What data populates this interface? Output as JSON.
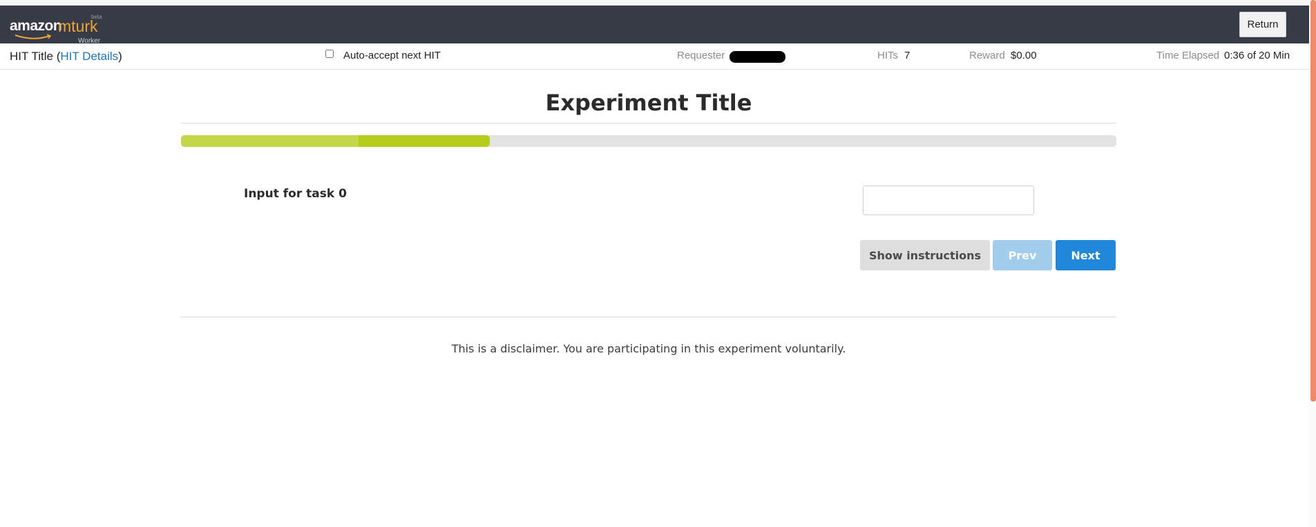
{
  "navbar": {
    "logo": {
      "amazon": "amazon",
      "mturk": "mturk",
      "beta": "beta",
      "worker": "Worker"
    },
    "return_label": "Return"
  },
  "infobar": {
    "hit_title": "HIT Title",
    "hit_details_link": "HIT Details",
    "auto_accept_label": "Auto-accept next HIT",
    "auto_accept_checked": false,
    "requester_label": "Requester",
    "hits_label": "HITs",
    "hits_value": "7",
    "reward_label": "Reward",
    "reward_value": "$0.00",
    "time_label": "Time Elapsed",
    "time_value": "0:36 of 20 Min"
  },
  "experiment": {
    "title": "Experiment Title",
    "progress": {
      "completed_fraction": 0.33,
      "segment_boundary_fraction": 0.19
    },
    "task_label": "Input for task 0",
    "input_value": "",
    "buttons": {
      "show_instructions": "Show instructions",
      "prev": "Prev",
      "next": "Next"
    },
    "disclaimer": "This is a disclaimer. You are participating in this experiment voluntarily."
  },
  "colors": {
    "navbar_bg": "#363b46",
    "mturk_orange": "#f0a33b",
    "link_blue": "#1f73b7",
    "progress_light": "#c2d84a",
    "progress_dark": "#b5cc1a",
    "next_blue": "#2187d9",
    "prev_disabled_blue": "#a3cdec",
    "scrollbar_orange": "#ef8a67"
  }
}
